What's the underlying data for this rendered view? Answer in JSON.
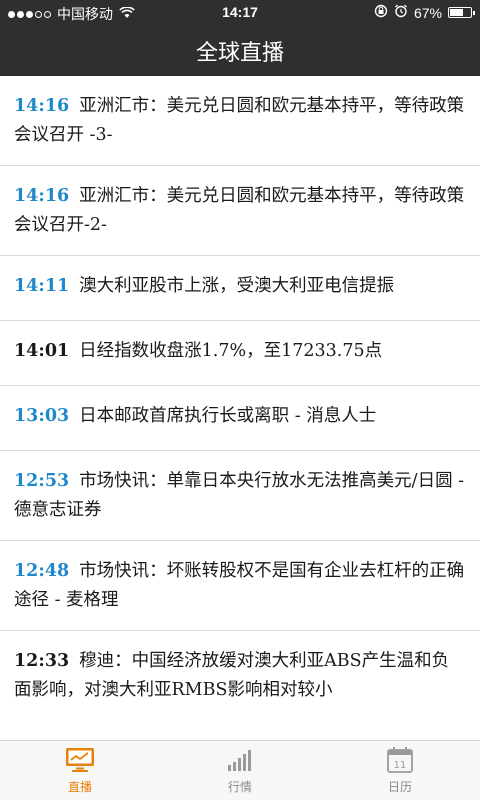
{
  "status": {
    "carrier": "中国移动",
    "time": "14:17",
    "battery": "67%",
    "battery_level": 0.67,
    "signal_bars": 3,
    "signal_total": 5
  },
  "header": {
    "title": "全球直播"
  },
  "feed": [
    {
      "time": "14:16",
      "text": "亚洲汇市：美元兑日圆和欧元基本持平，等待政策会议召开 -3-",
      "time_color": "blue"
    },
    {
      "time": "14:16",
      "text": "亚洲汇市：美元兑日圆和欧元基本持平，等待政策会议召开-2-",
      "time_color": "blue"
    },
    {
      "time": "14:11",
      "text": "澳大利亚股市上涨，受澳大利亚电信提振",
      "time_color": "blue"
    },
    {
      "time": "14:01",
      "text": "日经指数收盘涨1.7%，至17233.75点",
      "time_color": "dark"
    },
    {
      "time": "13:03",
      "text": "日本邮政首席执行长或离职 - 消息人士",
      "time_color": "blue"
    },
    {
      "time": "12:53",
      "text": "市场快讯：单靠日本央行放水无法推高美元/日圆 - 德意志证券",
      "time_color": "blue"
    },
    {
      "time": "12:48",
      "text": "市场快讯：坏账转股权不是国有企业去杠杆的正确途径 - 麦格理",
      "time_color": "blue"
    },
    {
      "time": "12:33",
      "text": "穆迪：中国经济放缓对澳大利亚ABS产生温和负面影响，对澳大利亚RMBS影响相对较小",
      "time_color": "dark"
    }
  ],
  "tabs": [
    {
      "label": "直播",
      "icon": "monitor-icon",
      "active": true
    },
    {
      "label": "行情",
      "icon": "bar-chart-icon",
      "active": false
    },
    {
      "label": "日历",
      "icon": "calendar-icon",
      "active": false
    }
  ],
  "calendar_icon_day": "11",
  "colors": {
    "accent": "#e8820c",
    "time_blue": "#1e88c8",
    "bar_bg": "#2f2f2f"
  }
}
